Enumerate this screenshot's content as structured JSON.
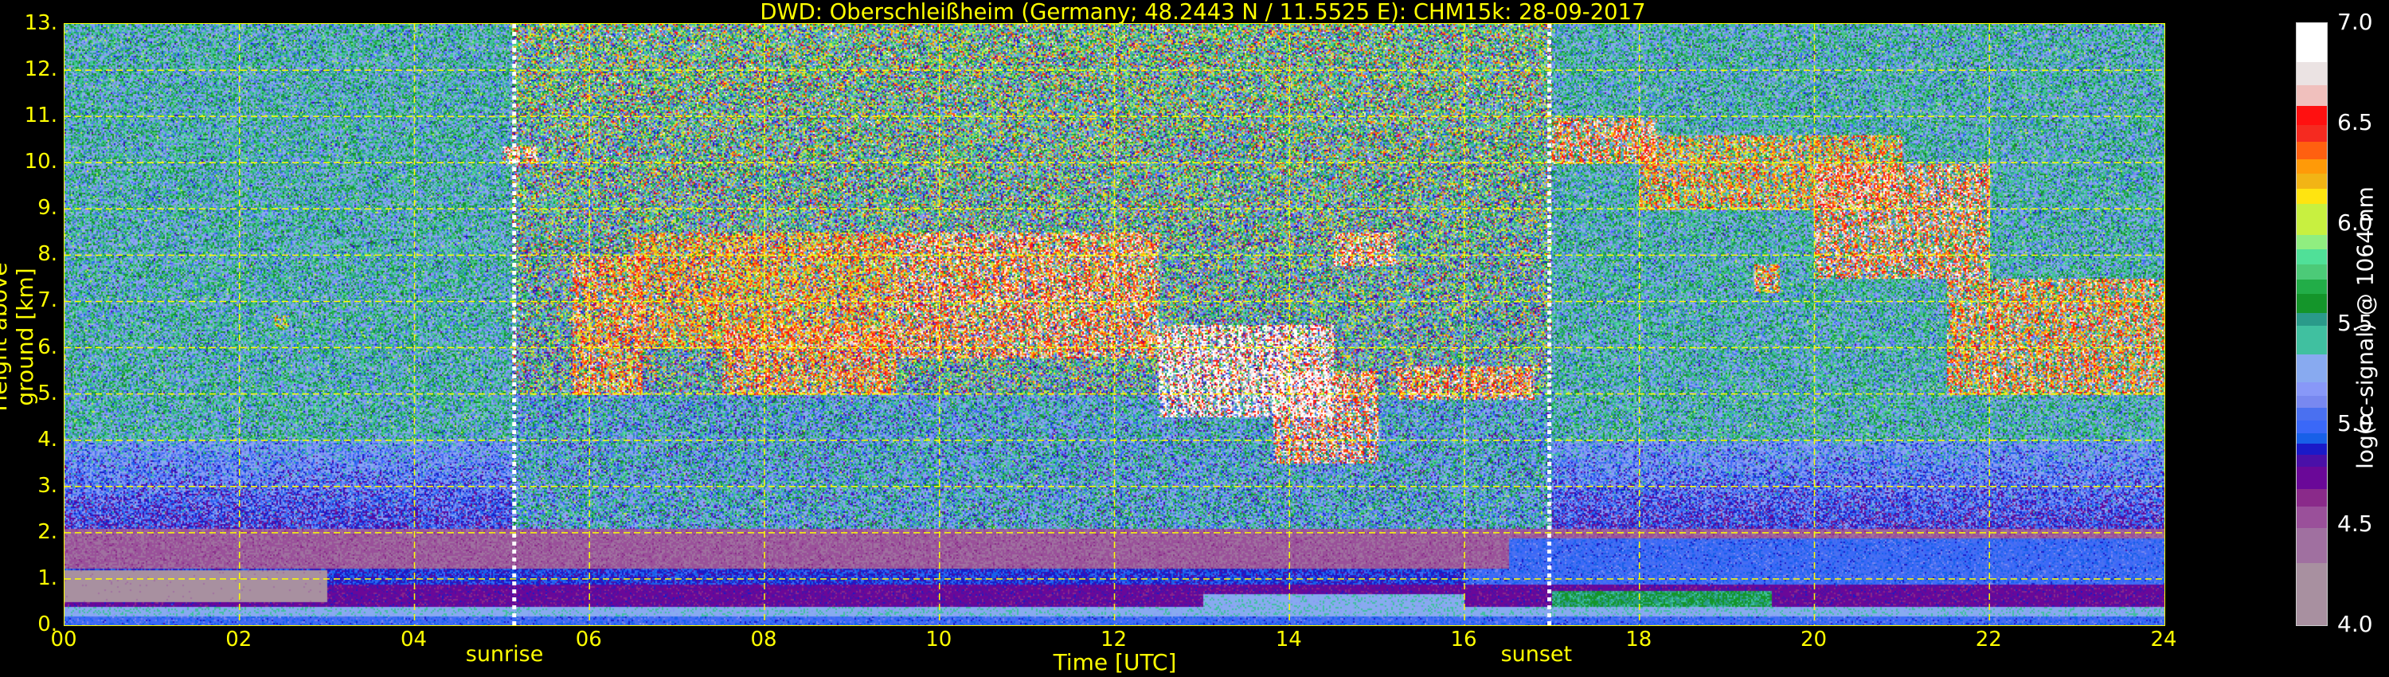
{
  "chart_data": {
    "type": "heatmap",
    "title": "DWD: Oberschleißheim (Germany; 48.2443 N / 11.5525 E):    CHM15k: 28-09-2017",
    "xlabel": "Time [UTC]",
    "ylabel": "Height above ground [km]",
    "xlim": [
      0,
      24
    ],
    "ylim": [
      0,
      13
    ],
    "xticks": [
      "00",
      "02",
      "04",
      "06",
      "08",
      "10",
      "12",
      "14",
      "16",
      "18",
      "20",
      "22",
      "24"
    ],
    "yticks": [
      "0.",
      "1.",
      "2.",
      "3.",
      "4.",
      "5.",
      "6.",
      "7.",
      "8.",
      "9.",
      "10.",
      "11.",
      "12.",
      "13."
    ],
    "grid": true,
    "annotations": [
      {
        "label": "sunrise",
        "x": 5.14
      },
      {
        "label": "sunset",
        "x": 16.97
      }
    ],
    "colorbar": {
      "label": "log(rc-signal) @ 1064 nm",
      "range": [
        4.0,
        7.0
      ],
      "ticks": [
        "4.0",
        "4.5",
        "5.0",
        "5.5",
        "6.0",
        "6.5",
        "7.0"
      ],
      "levels": [
        {
          "from": 6.807,
          "to": 7.0,
          "color": "#ffffff"
        },
        {
          "from": 6.689,
          "to": 6.807,
          "color": "#ebe3e3"
        },
        {
          "from": 6.586,
          "to": 6.689,
          "color": "#f0c0bd"
        },
        {
          "from": 6.494,
          "to": 6.586,
          "color": "#ff1010"
        },
        {
          "from": 6.408,
          "to": 6.494,
          "color": "#f52a20"
        },
        {
          "from": 6.322,
          "to": 6.408,
          "color": "#ff6010"
        },
        {
          "from": 6.249,
          "to": 6.322,
          "color": "#ff9a08"
        },
        {
          "from": 6.174,
          "to": 6.249,
          "color": "#f2b415"
        },
        {
          "from": 6.099,
          "to": 6.174,
          "color": "#ffe410"
        },
        {
          "from": 5.946,
          "to": 6.099,
          "color": "#c8f040"
        },
        {
          "from": 5.873,
          "to": 5.946,
          "color": "#90ee80"
        },
        {
          "from": 5.798,
          "to": 5.873,
          "color": "#50e098"
        },
        {
          "from": 5.723,
          "to": 5.798,
          "color": "#4cca78"
        },
        {
          "from": 5.65,
          "to": 5.723,
          "color": "#22ad48"
        },
        {
          "from": 5.556,
          "to": 5.65,
          "color": "#14952a"
        },
        {
          "from": 5.491,
          "to": 5.556,
          "color": "#2a9a8a"
        },
        {
          "from": 5.348,
          "to": 5.491,
          "color": "#40c0a0"
        },
        {
          "from": 5.212,
          "to": 5.348,
          "color": "#88aaf0"
        },
        {
          "from": 5.144,
          "to": 5.212,
          "color": "#8898f8"
        },
        {
          "from": 5.082,
          "to": 5.144,
          "color": "#7888f0"
        },
        {
          "from": 5.019,
          "to": 5.082,
          "color": "#4a70f0"
        },
        {
          "from": 4.955,
          "to": 5.019,
          "color": "#3a68f8"
        },
        {
          "from": 4.906,
          "to": 4.955,
          "color": "#1860e8"
        },
        {
          "from": 4.848,
          "to": 4.906,
          "color": "#1a1ac8"
        },
        {
          "from": 4.788,
          "to": 4.848,
          "color": "#4a10a8"
        },
        {
          "from": 4.68,
          "to": 4.788,
          "color": "#6a0898"
        },
        {
          "from": 4.59,
          "to": 4.68,
          "color": "#8a2a8a"
        },
        {
          "from": 4.483,
          "to": 4.59,
          "color": "#9a509a"
        },
        {
          "from": 4.311,
          "to": 4.483,
          "color": "#a070a0"
        },
        {
          "from": 4.0,
          "to": 4.311,
          "color": "#a890a0"
        }
      ]
    },
    "cloud_features": [
      {
        "t": [
          5.0,
          5.4
        ],
        "h": [
          10.0,
          10.35
        ],
        "v": 6.6
      },
      {
        "t": [
          5.8,
          6.6
        ],
        "h": [
          5.0,
          8.0
        ],
        "v": 6.4
      },
      {
        "t": [
          6.5,
          9.5
        ],
        "h": [
          6.0,
          8.5
        ],
        "v": 6.3
      },
      {
        "t": [
          7.5,
          9.5
        ],
        "h": [
          5.0,
          6.5
        ],
        "v": 6.4
      },
      {
        "t": [
          9.5,
          12.5
        ],
        "h": [
          5.8,
          8.5
        ],
        "v": 6.5
      },
      {
        "t": [
          12.5,
          14.5
        ],
        "h": [
          4.5,
          6.5
        ],
        "v": 6.8
      },
      {
        "t": [
          13.8,
          15.0
        ],
        "h": [
          3.5,
          5.5
        ],
        "v": 6.6
      },
      {
        "t": [
          14.5,
          15.2
        ],
        "h": [
          7.8,
          8.5
        ],
        "v": 6.6
      },
      {
        "t": [
          15.2,
          16.8
        ],
        "h": [
          4.9,
          5.6
        ],
        "v": 6.5
      },
      {
        "t": [
          17.0,
          18.2
        ],
        "h": [
          10.0,
          11.0
        ],
        "v": 6.5
      },
      {
        "t": [
          18.0,
          21.0
        ],
        "h": [
          9.0,
          10.6
        ],
        "v": 6.3
      },
      {
        "t": [
          20.0,
          22.0
        ],
        "h": [
          7.5,
          10.0
        ],
        "v": 6.5
      },
      {
        "t": [
          19.3,
          19.6
        ],
        "h": [
          7.2,
          7.8
        ],
        "v": 6.4
      },
      {
        "t": [
          21.5,
          24.0
        ],
        "h": [
          5.0,
          7.5
        ],
        "v": 6.4
      },
      {
        "t": [
          2.4,
          2.55
        ],
        "h": [
          6.4,
          6.7
        ],
        "v": 6.0
      }
    ]
  }
}
